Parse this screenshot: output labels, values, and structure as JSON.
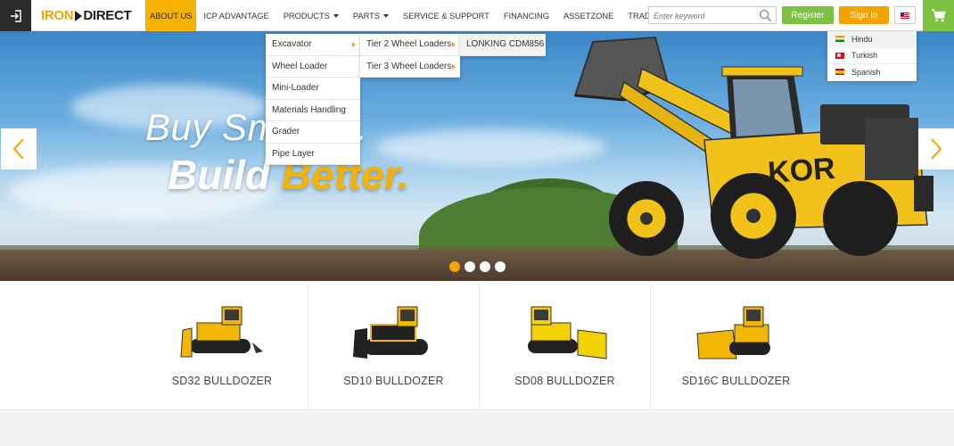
{
  "header": {
    "logo_iron": "IRON",
    "logo_direct": "DIRECT",
    "nav": [
      {
        "label": "ABOUT US",
        "active": true
      },
      {
        "label": "ICP ADVANTAGE"
      },
      {
        "label": "PRODUCTS",
        "has_caret": true,
        "open": true
      },
      {
        "label": "PARTS",
        "has_caret": true
      },
      {
        "label": "SERVICE & SUPPORT"
      },
      {
        "label": "FINANCING"
      },
      {
        "label": "ASSETZONE"
      },
      {
        "label": "TRADE-INS"
      }
    ],
    "search_placeholder": "Enter keyword",
    "register_label": "Register",
    "signin_label": "Sign In",
    "current_language_flag": "us-flag-icon",
    "colors": {
      "accent": "#f5a300",
      "green": "#7dc242",
      "nav_active": "#f5b300"
    }
  },
  "hero": {
    "line1": "Buy Smarter.",
    "line2_a": "Build ",
    "line2_b": "Better.",
    "slides_total": 4,
    "active_slide": 1
  },
  "products_menu": [
    "Excavator",
    "Wheel Loader",
    "Mini-Loader",
    "Materials Handling",
    "Grader",
    "Pipe Layer"
  ],
  "wheel_loader_menu": [
    "Tier 2 Wheel Loaders",
    "Tier 3 Wheel Loaders"
  ],
  "tier2_menu": [
    "LONKING CDM856"
  ],
  "language_menu": [
    {
      "label": "Hindu",
      "flag": "india-flag-icon"
    },
    {
      "label": "Turkish",
      "flag": "turkey-flag-icon"
    },
    {
      "label": "Spanish",
      "flag": "spain-flag-icon"
    }
  ],
  "products": [
    {
      "name": "SD32 BULLDOZER"
    },
    {
      "name": "SD10 BULLDOZER"
    },
    {
      "name": "SD08 BULLDOZER"
    },
    {
      "name": "SD16C BULLDOZER"
    }
  ]
}
